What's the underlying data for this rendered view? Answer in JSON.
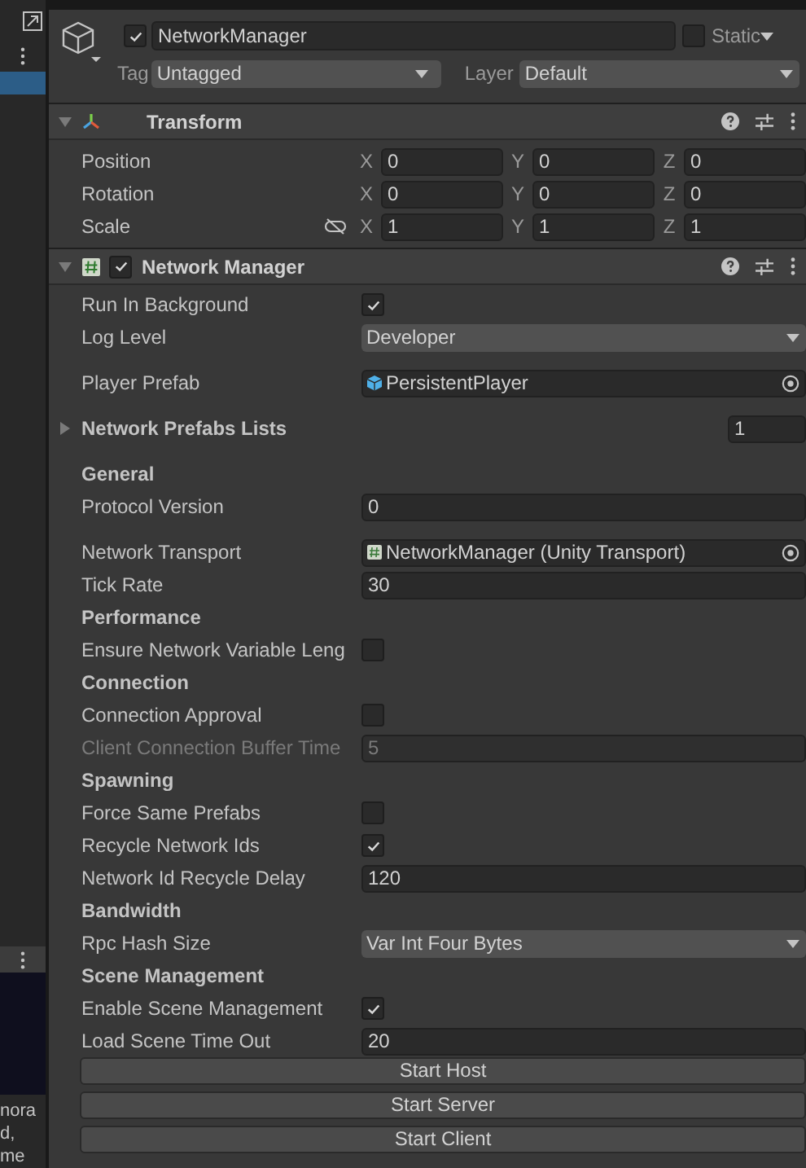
{
  "left_panel": {
    "snippets": [
      "nora",
      "d,",
      "me"
    ]
  },
  "object": {
    "active": true,
    "name": "NetworkManager",
    "static_label": "Static",
    "static": false,
    "tag_label": "Tag",
    "tag": "Untagged",
    "layer_label": "Layer",
    "layer": "Default"
  },
  "transform": {
    "title": "Transform",
    "expanded": true,
    "rows": [
      {
        "label": "Position",
        "linked": false,
        "values": [
          {
            "axis": "X",
            "value": "0"
          },
          {
            "axis": "Y",
            "value": "0"
          },
          {
            "axis": "Z",
            "value": "0"
          }
        ]
      },
      {
        "label": "Rotation",
        "linked": false,
        "values": [
          {
            "axis": "X",
            "value": "0"
          },
          {
            "axis": "Y",
            "value": "0"
          },
          {
            "axis": "Z",
            "value": "0"
          }
        ]
      },
      {
        "label": "Scale",
        "linked": true,
        "values": [
          {
            "axis": "X",
            "value": "1"
          },
          {
            "axis": "Y",
            "value": "1"
          },
          {
            "axis": "Z",
            "value": "1"
          }
        ]
      }
    ]
  },
  "component": {
    "title": "Network Manager",
    "enabled": true,
    "expanded": true,
    "properties": [
      {
        "kind": "checkbox",
        "label": "Run In Background",
        "checked": true
      },
      {
        "kind": "dropdown",
        "label": "Log Level",
        "value": "Developer"
      },
      {
        "kind": "prefab_object",
        "label": "Player Prefab",
        "value": "PersistentPlayer"
      },
      {
        "kind": "foldout",
        "label": "Network Prefabs Lists",
        "expanded": false,
        "value": "1"
      },
      {
        "kind": "header",
        "label": "General"
      },
      {
        "kind": "field",
        "label": "Protocol Version",
        "value": "0",
        "disabled": false
      },
      {
        "kind": "script_object",
        "label": "Network Transport",
        "value": "NetworkManager (Unity Transport)"
      },
      {
        "kind": "field",
        "label": "Tick Rate",
        "value": "30",
        "disabled": false
      },
      {
        "kind": "header",
        "label": "Performance"
      },
      {
        "kind": "checkbox",
        "label": "Ensure Network Variable Leng",
        "checked": false
      },
      {
        "kind": "header",
        "label": "Connection"
      },
      {
        "kind": "checkbox",
        "label": "Connection Approval",
        "checked": false
      },
      {
        "kind": "field",
        "label": "Client Connection Buffer Time",
        "value": "5",
        "disabled": true
      },
      {
        "kind": "header",
        "label": "Spawning"
      },
      {
        "kind": "checkbox",
        "label": "Force Same Prefabs",
        "checked": false
      },
      {
        "kind": "checkbox",
        "label": "Recycle Network Ids",
        "checked": true
      },
      {
        "kind": "field",
        "label": "Network Id Recycle Delay",
        "value": "120",
        "disabled": false
      },
      {
        "kind": "header",
        "label": "Bandwidth"
      },
      {
        "kind": "dropdown",
        "label": "Rpc Hash Size",
        "value": "Var Int Four Bytes"
      },
      {
        "kind": "header",
        "label": "Scene Management"
      },
      {
        "kind": "checkbox",
        "label": "Enable Scene Management",
        "checked": true
      },
      {
        "kind": "field",
        "label": "Load Scene Time Out",
        "value": "20",
        "disabled": false
      }
    ]
  },
  "buttons": [
    "Start Host",
    "Start Server",
    "Start Client"
  ]
}
